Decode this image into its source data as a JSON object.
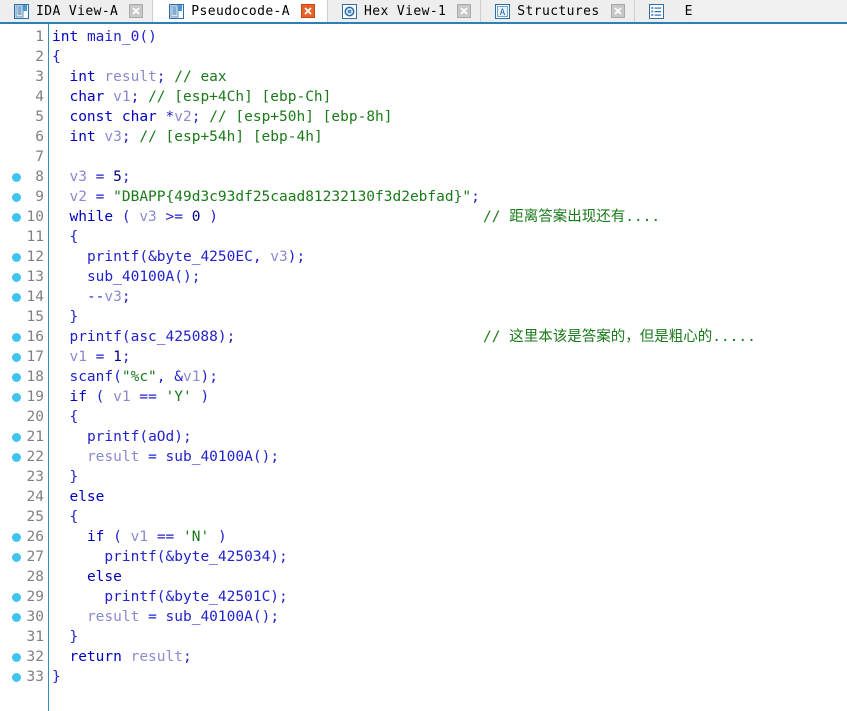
{
  "window": {
    "accent_color": "#2d7fb5",
    "background": "#ffffff"
  },
  "tabs": [
    {
      "label": "IDA View-A",
      "icon": "document-list-icon",
      "active": false,
      "close_icon": "close-icon",
      "close_state": "normal"
    },
    {
      "label": "Pseudocode-A",
      "icon": "document-list-icon",
      "active": true,
      "close_icon": "close-icon",
      "close_state": "highlighted"
    },
    {
      "label": "Hex View-1",
      "icon": "hex-view-icon",
      "active": false,
      "close_icon": "close-icon",
      "close_state": "normal"
    },
    {
      "label": "Structures",
      "icon": "structures-icon",
      "active": false,
      "close_icon": "close-icon",
      "close_state": "normal"
    },
    {
      "label": "E",
      "icon": "enums-icon",
      "active": false,
      "close_icon": "close-icon",
      "close_state": "normal"
    }
  ],
  "editor": {
    "function_name": "main_0",
    "flag_string": "DBAPP{49d3c93df25caad81232130f3d2ebfad}",
    "comment_line_10": "// 距离答案出现还有....",
    "comment_line_16": "// 这里本该是答案的，但是粗心的.....",
    "lines": [
      {
        "n": "1",
        "bp": false,
        "code": "int main_0()"
      },
      {
        "n": "2",
        "bp": false,
        "code": "{"
      },
      {
        "n": "3",
        "bp": false,
        "code": "  int result; // eax"
      },
      {
        "n": "4",
        "bp": false,
        "code": "  char v1; // [esp+4Ch] [ebp-Ch]"
      },
      {
        "n": "5",
        "bp": false,
        "code": "  const char *v2; // [esp+50h] [ebp-8h]"
      },
      {
        "n": "6",
        "bp": false,
        "code": "  int v3; // [esp+54h] [ebp-4h]"
      },
      {
        "n": "7",
        "bp": false,
        "code": ""
      },
      {
        "n": "8",
        "bp": true,
        "code": "  v3 = 5;"
      },
      {
        "n": "9",
        "bp": true,
        "code": "  v2 = \"DBAPP{49d3c93df25caad81232130f3d2ebfad}\";"
      },
      {
        "n": "10",
        "bp": true,
        "code": "  while ( v3 >= 0 )",
        "comment": "// 距离答案出现还有...."
      },
      {
        "n": "11",
        "bp": false,
        "code": "  {"
      },
      {
        "n": "12",
        "bp": true,
        "code": "    printf(&byte_4250EC, v3);"
      },
      {
        "n": "13",
        "bp": true,
        "code": "    sub_40100A();"
      },
      {
        "n": "14",
        "bp": true,
        "code": "    --v3;"
      },
      {
        "n": "15",
        "bp": false,
        "code": "  }"
      },
      {
        "n": "16",
        "bp": true,
        "code": "  printf(asc_425088);",
        "comment": "// 这里本该是答案的，但是粗心的....."
      },
      {
        "n": "17",
        "bp": true,
        "code": "  v1 = 1;"
      },
      {
        "n": "18",
        "bp": true,
        "code": "  scanf(\"%c\", &v1);"
      },
      {
        "n": "19",
        "bp": true,
        "code": "  if ( v1 == 'Y' )"
      },
      {
        "n": "20",
        "bp": false,
        "code": "  {"
      },
      {
        "n": "21",
        "bp": true,
        "code": "    printf(aOd);"
      },
      {
        "n": "22",
        "bp": true,
        "code": "    result = sub_40100A();"
      },
      {
        "n": "23",
        "bp": false,
        "code": "  }"
      },
      {
        "n": "24",
        "bp": false,
        "code": "  else"
      },
      {
        "n": "25",
        "bp": false,
        "code": "  {"
      },
      {
        "n": "26",
        "bp": true,
        "code": "    if ( v1 == 'N' )"
      },
      {
        "n": "27",
        "bp": true,
        "code": "      printf(&byte_425034);"
      },
      {
        "n": "28",
        "bp": false,
        "code": "    else"
      },
      {
        "n": "29",
        "bp": true,
        "code": "      printf(&byte_42501C);"
      },
      {
        "n": "30",
        "bp": true,
        "code": "    result = sub_40100A();"
      },
      {
        "n": "31",
        "bp": false,
        "code": "  }"
      },
      {
        "n": "32",
        "bp": true,
        "code": "  return result;"
      },
      {
        "n": "33",
        "bp": true,
        "code": "}"
      }
    ]
  }
}
